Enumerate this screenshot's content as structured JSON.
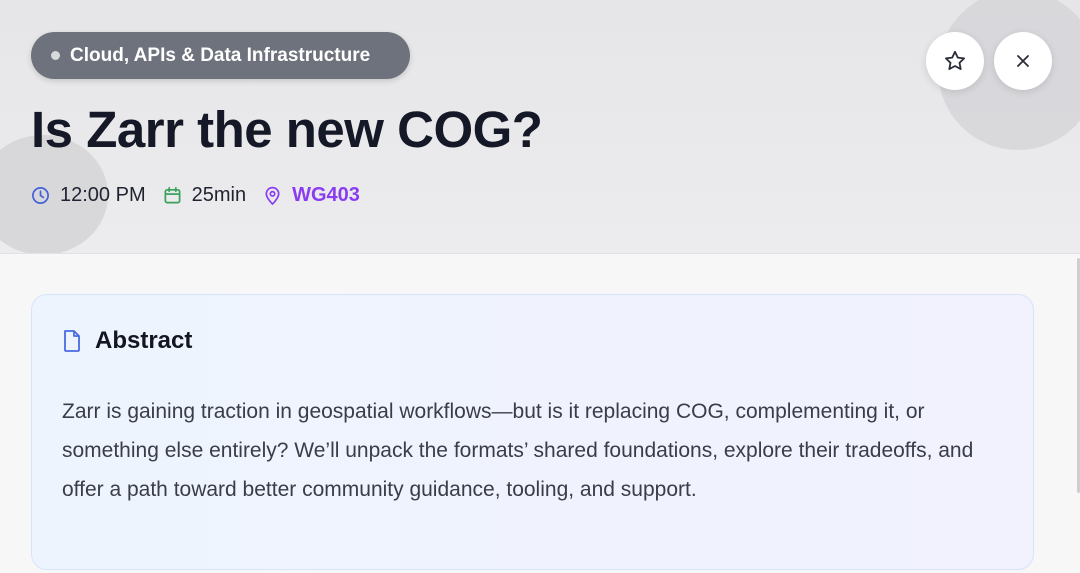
{
  "session": {
    "track": "Cloud, APIs & Data Infrastructure",
    "title": "Is Zarr the new COG?",
    "time": "12:00 PM",
    "duration": "25min",
    "room": "WG403"
  },
  "actions": {
    "favorite_icon": "star-outline-icon",
    "close_icon": "close-x-icon"
  },
  "abstract": {
    "heading": "Abstract",
    "icon": "document-icon",
    "text": "Zarr is gaining traction in geospatial workflows—but is it replacing COG, complementing it, or something else entirely? We’ll unpack the formats’ shared foundations, explore their tradeoffs, and offer a path toward better community guidance, tooling, and support."
  },
  "colors": {
    "tag_bg": "#6e727c",
    "time_icon": "#4560d8",
    "calendar_icon": "#3aa05a",
    "location": "#8a3cf0",
    "abstract_icon": "#4a6ae0"
  }
}
